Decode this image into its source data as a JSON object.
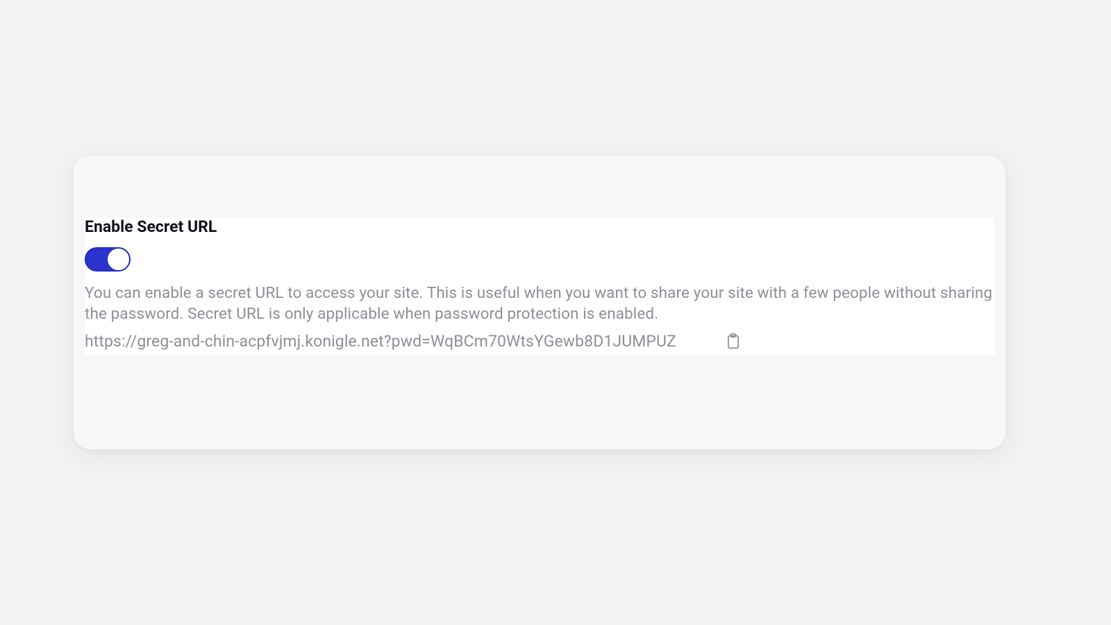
{
  "secretUrl": {
    "title": "Enable Secret URL",
    "toggle_on": true,
    "description": "You can enable a secret URL to access your site. This is useful when you want to share your site with a few people without sharing the password. Secret URL is only applicable when password protection is enabled.",
    "url": "https://greg-and-chin-acpfvjmj.konigle.net?pwd=WqBCm70WtsYGewb8D1JUMPUZ"
  },
  "colors": {
    "toggle_on_bg": "#2a33cc",
    "muted_text": "#8e8e99",
    "page_bg": "#f2f2f2",
    "card_bg": "#f7f7f8",
    "panel_bg": "#ffffff",
    "heading": "#0f0f1a"
  }
}
